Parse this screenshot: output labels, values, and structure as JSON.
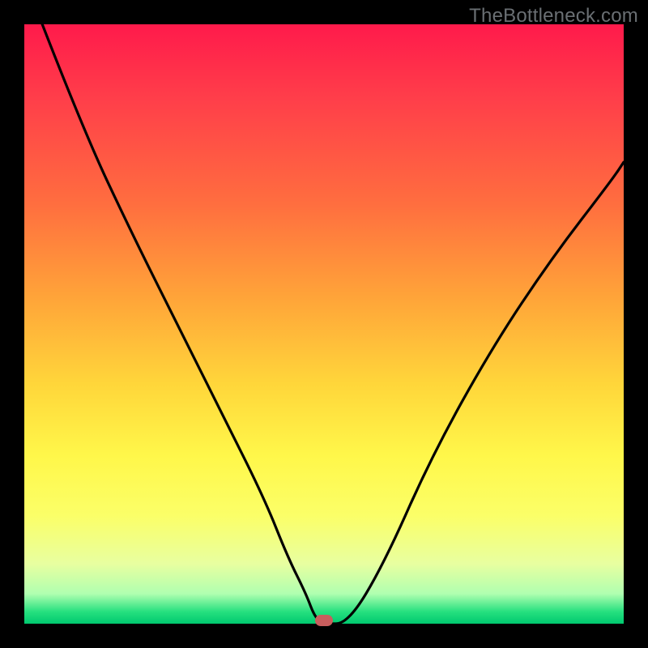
{
  "watermark": "TheBottleneck.com",
  "colors": {
    "frame": "#000000",
    "curve": "#000000",
    "marker": "#c85d5d"
  },
  "chart_data": {
    "type": "line",
    "title": "",
    "xlabel": "",
    "ylabel": "",
    "xlim": [
      0,
      100
    ],
    "ylim": [
      0,
      100
    ],
    "grid": false,
    "series": [
      {
        "name": "curve",
        "x": [
          3,
          10,
          18,
          26,
          33,
          40,
          44,
          47,
          48.5,
          50,
          54,
          60,
          68,
          78,
          88,
          98,
          100
        ],
        "y": [
          100,
          82,
          65,
          49,
          35,
          21,
          11,
          5,
          1,
          0,
          0,
          10,
          28,
          46,
          61,
          74,
          77
        ]
      }
    ],
    "marker": {
      "x": 50,
      "y": 0
    },
    "gradient_stops": [
      {
        "pos": 0,
        "color": "#ff1a4b"
      },
      {
        "pos": 12,
        "color": "#ff3d4a"
      },
      {
        "pos": 30,
        "color": "#ff6e3f"
      },
      {
        "pos": 45,
        "color": "#ffa239"
      },
      {
        "pos": 60,
        "color": "#ffd63a"
      },
      {
        "pos": 72,
        "color": "#fff74a"
      },
      {
        "pos": 82,
        "color": "#fbff68"
      },
      {
        "pos": 90,
        "color": "#e8ffa0"
      },
      {
        "pos": 95,
        "color": "#b0ffb0"
      },
      {
        "pos": 98,
        "color": "#26e07f"
      },
      {
        "pos": 100,
        "color": "#00c96f"
      }
    ]
  }
}
